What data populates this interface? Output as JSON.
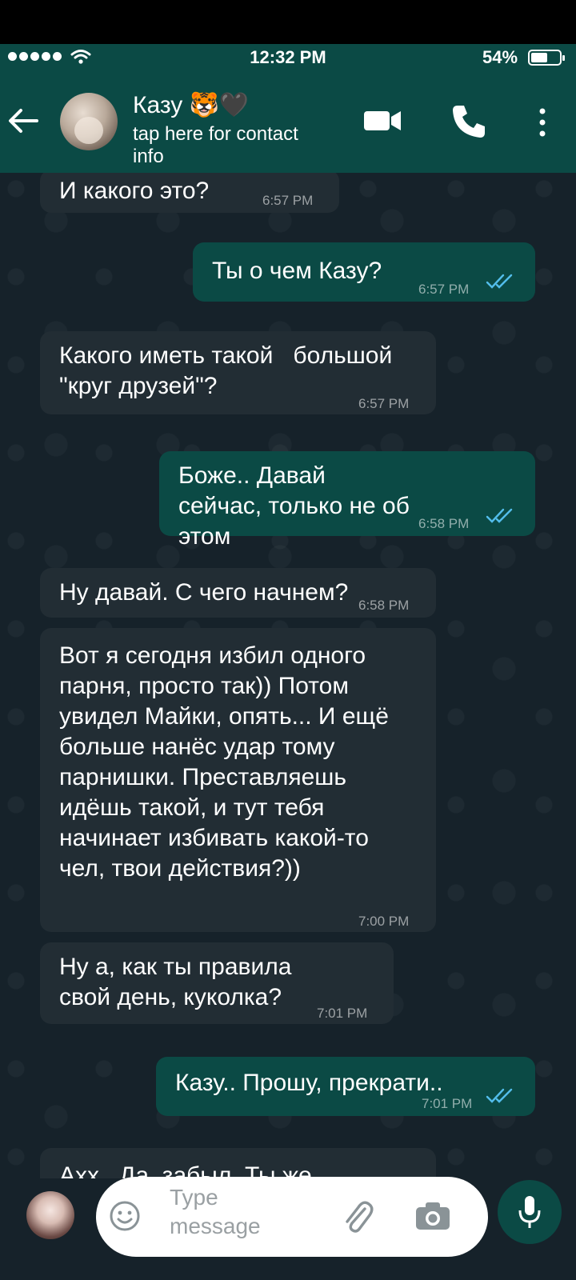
{
  "status_bar": {
    "time": "12:32 PM",
    "battery": "54%"
  },
  "header": {
    "contact_name": "Казу 🐯🖤",
    "subtitle": "tap here for contact info"
  },
  "messages": [
    {
      "dir": "in",
      "text": "И какого это?",
      "time": "6:57 PM"
    },
    {
      "dir": "out",
      "text": "Ты о чем Казу?",
      "time": "6:57 PM",
      "read": true
    },
    {
      "dir": "in",
      "text": "Какого иметь такой   большой \"круг друзей\"?",
      "time": "6:57 PM"
    },
    {
      "dir": "out",
      "text": "Боже.. Давай сейчас, только не об этом",
      "time": "6:58 PM",
      "read": true
    },
    {
      "dir": "in",
      "text": "Ну давай. С чего начнем?",
      "time": "6:58 PM"
    },
    {
      "dir": "in",
      "text": "Вот я сегодня избил одного парня, просто так)) Потом увидел Майки, опять... И ещё больше нанёс удар тому парнишки. Преставляешь идёшь такой, и тут тебя начинает избивать какой-то чел, твои действия?))",
      "time": "7:00 PM"
    },
    {
      "dir": "in",
      "text": "Ну а, как ты правила свой день, куколка?",
      "time": "7:01 PM"
    },
    {
      "dir": "out",
      "text": "Казу.. Прошу, прекрати..",
      "time": "7:01 PM",
      "read": true
    },
    {
      "dir": "in",
      "text": "Ахх.. Да, забыл. Ты же",
      "time": ""
    }
  ],
  "composer": {
    "placeholder": "Type message"
  },
  "colors": {
    "header": "#0b4a45",
    "chat_bg": "#16222a",
    "incoming": "#222d34",
    "outgoing": "#0b4a45",
    "tick": "#53bdeb"
  }
}
